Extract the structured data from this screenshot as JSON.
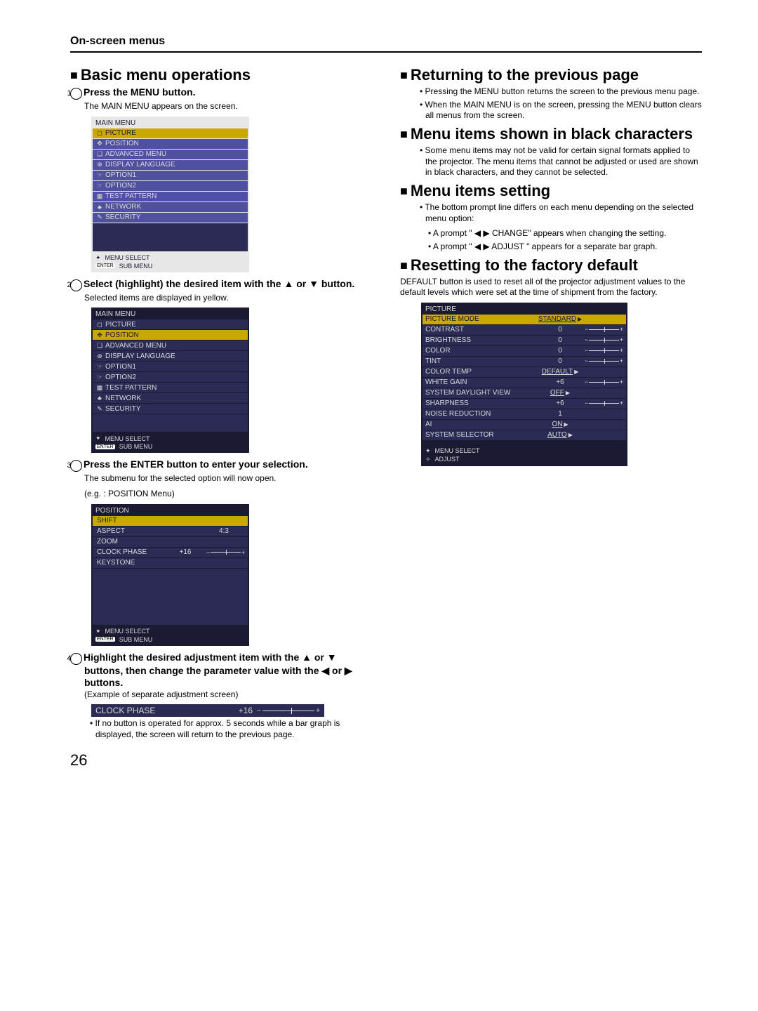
{
  "page_number": "26",
  "header": "On-screen menus",
  "left": {
    "h2_basic": "Basic menu operations",
    "step1_h": "Press the MENU button.",
    "step1_p": "The MAIN MENU appears on the screen.",
    "step2_h": "Select (highlight) the desired item with the  ▲  or  ▼  button.",
    "step2_p": "Selected items are displayed in yellow.",
    "step3_h": "Press the ENTER button to enter your selection.",
    "step3_p1": "The submenu for the selected option will now open.",
    "step3_p2": "(e.g. : POSITION Menu)",
    "step4_h": "Highlight the desired adjustment item with the  ▲  or  ▼ buttons, then change the parameter value with the  ◀ or ▶ buttons.",
    "step4_p": "(Example of separate adjustment screen)",
    "step4_bul": "If no button is operated for approx. 5 seconds while a bar graph is displayed, the screen will return to the previous page."
  },
  "right": {
    "h2_return": "Returning to the previous page",
    "return_b1": "Pressing the MENU button returns the screen to the previous menu page.",
    "return_b2": "When the MAIN MENU is on the screen, pressing the MENU button clears all menus from the screen.",
    "h2_black": "Menu items shown in black characters",
    "black_b1": "Some menu items may not be valid for certain signal formats applied to the projector. The menu items that cannot be adjusted or used are shown in black characters, and they cannot be selected.",
    "h2_setting": "Menu items setting",
    "set_b1": "The bottom prompt line differs on each menu depending on the selected menu option:",
    "set_b2a": "A prompt \"  ◀   ▶  CHANGE\" appears when changing the setting.",
    "set_b2b": "A prompt \"  ◀   ▶  ADJUST  \" appears for a separate bar graph.",
    "h2_reset": "Resetting to the factory default",
    "reset_p": "DEFAULT button is used to reset all of the projector adjustment values to the default levels which were set at the time of shipment from the factory."
  },
  "osd_main": {
    "title": "MAIN MENU",
    "items": [
      {
        "icon": "◻",
        "label": "PICTURE"
      },
      {
        "icon": "✥",
        "label": "POSITION"
      },
      {
        "icon": "❏",
        "label": "ADVANCED MENU"
      },
      {
        "icon": "⊕",
        "label": "DISPLAY LANGUAGE"
      },
      {
        "icon": "☞",
        "label": "OPTION1"
      },
      {
        "icon": "☞",
        "label": "OPTION2"
      },
      {
        "icon": "▦",
        "label": "TEST PATTERN"
      },
      {
        "icon": "♣",
        "label": "NETWORK"
      },
      {
        "icon": "✎",
        "label": "SECURITY"
      }
    ],
    "foot1": "MENU SELECT",
    "foot2": "SUB MENU",
    "enter": "ENTER"
  },
  "osd_position": {
    "title": "POSITION",
    "items": [
      {
        "label": "SHIFT",
        "val": ""
      },
      {
        "label": "ASPECT",
        "val": "4:3"
      },
      {
        "label": "ZOOM",
        "val": ""
      },
      {
        "label": "CLOCK PHASE",
        "val": "+16",
        "slider": true
      },
      {
        "label": "KEYSTONE",
        "val": ""
      }
    ],
    "foot1": "MENU SELECT",
    "foot2": "SUB MENU",
    "enter": "ENTER"
  },
  "adj": {
    "name": "CLOCK PHASE",
    "val": "+16"
  },
  "osd_picture": {
    "title": "PICTURE",
    "items": [
      {
        "label": "PICTURE MODE",
        "val": "STANDARD",
        "arrow": true,
        "hl": true
      },
      {
        "label": "CONTRAST",
        "val": "0",
        "slider": true
      },
      {
        "label": "BRIGHTNESS",
        "val": "0",
        "slider": true
      },
      {
        "label": "COLOR",
        "val": "0",
        "slider": true
      },
      {
        "label": "TINT",
        "val": "0",
        "slider": true
      },
      {
        "label": "COLOR TEMP",
        "val": "DEFAULT",
        "arrow": true
      },
      {
        "label": "WHITE GAIN",
        "val": "+6",
        "slider": true
      },
      {
        "label": "SYSTEM DAYLIGHT VIEW",
        "val": "OFF",
        "arrow": true
      },
      {
        "label": "SHARPNESS",
        "val": "+6",
        "slider": true
      },
      {
        "label": "NOISE REDUCTION",
        "val": "1"
      },
      {
        "label": "AI",
        "val": "ON",
        "arrow": true
      },
      {
        "label": "SYSTEM SELECTOR",
        "val": "AUTO",
        "arrow": true
      }
    ],
    "foot1": "MENU SELECT",
    "foot2": "ADJUST"
  }
}
